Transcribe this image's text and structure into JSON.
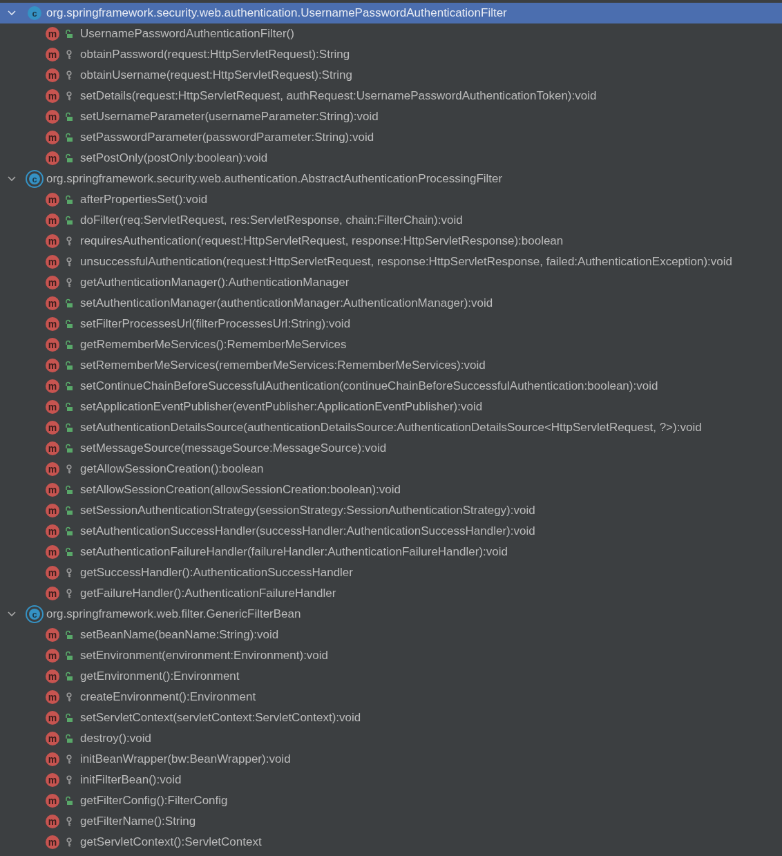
{
  "tree": [
    {
      "badge": "c",
      "name": "org.springframework.security.web.authentication.UsernamePasswordAuthenticationFilter",
      "selected": true,
      "expanded": true,
      "kind": "class",
      "children": [
        {
          "badge": "m",
          "kind": "public",
          "name": "UsernamePasswordAuthenticationFilter()"
        },
        {
          "badge": "m",
          "kind": "protected",
          "name": "obtainPassword(request:HttpServletRequest):String"
        },
        {
          "badge": "m",
          "kind": "protected",
          "name": "obtainUsername(request:HttpServletRequest):String"
        },
        {
          "badge": "m",
          "kind": "protected",
          "name": "setDetails(request:HttpServletRequest, authRequest:UsernamePasswordAuthenticationToken):void"
        },
        {
          "badge": "m",
          "kind": "public",
          "name": "setUsernameParameter(usernameParameter:String):void"
        },
        {
          "badge": "m",
          "kind": "public",
          "name": "setPasswordParameter(passwordParameter:String):void"
        },
        {
          "badge": "m",
          "kind": "public",
          "name": "setPostOnly(postOnly:boolean):void"
        }
      ]
    },
    {
      "badge": "c",
      "name": "org.springframework.security.web.authentication.AbstractAuthenticationProcessingFilter",
      "selected": false,
      "expanded": true,
      "kind": "abstract",
      "children": [
        {
          "badge": "m",
          "kind": "public",
          "name": "afterPropertiesSet():void"
        },
        {
          "badge": "m",
          "kind": "public",
          "name": "doFilter(req:ServletRequest, res:ServletResponse, chain:FilterChain):void"
        },
        {
          "badge": "m",
          "kind": "protected",
          "name": "requiresAuthentication(request:HttpServletRequest, response:HttpServletResponse):boolean"
        },
        {
          "badge": "m",
          "kind": "protected",
          "name": "unsuccessfulAuthentication(request:HttpServletRequest, response:HttpServletResponse, failed:AuthenticationException):void"
        },
        {
          "badge": "m",
          "kind": "protected",
          "name": "getAuthenticationManager():AuthenticationManager"
        },
        {
          "badge": "m",
          "kind": "public",
          "name": "setAuthenticationManager(authenticationManager:AuthenticationManager):void"
        },
        {
          "badge": "m",
          "kind": "public",
          "name": "setFilterProcessesUrl(filterProcessesUrl:String):void"
        },
        {
          "badge": "m",
          "kind": "public",
          "name": "getRememberMeServices():RememberMeServices"
        },
        {
          "badge": "m",
          "kind": "public",
          "name": "setRememberMeServices(rememberMeServices:RememberMeServices):void"
        },
        {
          "badge": "m",
          "kind": "public",
          "name": "setContinueChainBeforeSuccessfulAuthentication(continueChainBeforeSuccessfulAuthentication:boolean):void"
        },
        {
          "badge": "m",
          "kind": "public",
          "name": "setApplicationEventPublisher(eventPublisher:ApplicationEventPublisher):void"
        },
        {
          "badge": "m",
          "kind": "public",
          "name": "setAuthenticationDetailsSource(authenticationDetailsSource:AuthenticationDetailsSource<HttpServletRequest, ?>):void"
        },
        {
          "badge": "m",
          "kind": "public",
          "name": "setMessageSource(messageSource:MessageSource):void"
        },
        {
          "badge": "m",
          "kind": "protected",
          "name": "getAllowSessionCreation():boolean"
        },
        {
          "badge": "m",
          "kind": "public",
          "name": "setAllowSessionCreation(allowSessionCreation:boolean):void"
        },
        {
          "badge": "m",
          "kind": "public",
          "name": "setSessionAuthenticationStrategy(sessionStrategy:SessionAuthenticationStrategy):void"
        },
        {
          "badge": "m",
          "kind": "public",
          "name": "setAuthenticationSuccessHandler(successHandler:AuthenticationSuccessHandler):void"
        },
        {
          "badge": "m",
          "kind": "public",
          "name": "setAuthenticationFailureHandler(failureHandler:AuthenticationFailureHandler):void"
        },
        {
          "badge": "m",
          "kind": "protected",
          "name": "getSuccessHandler():AuthenticationSuccessHandler"
        },
        {
          "badge": "m",
          "kind": "protected",
          "name": "getFailureHandler():AuthenticationFailureHandler"
        }
      ]
    },
    {
      "badge": "c",
      "name": "org.springframework.web.filter.GenericFilterBean",
      "selected": false,
      "expanded": true,
      "kind": "abstract",
      "children": [
        {
          "badge": "m",
          "kind": "public",
          "name": "setBeanName(beanName:String):void"
        },
        {
          "badge": "m",
          "kind": "public",
          "name": "setEnvironment(environment:Environment):void"
        },
        {
          "badge": "m",
          "kind": "public",
          "name": "getEnvironment():Environment"
        },
        {
          "badge": "m",
          "kind": "protected",
          "name": "createEnvironment():Environment"
        },
        {
          "badge": "m",
          "kind": "public",
          "name": "setServletContext(servletContext:ServletContext):void"
        },
        {
          "badge": "m",
          "kind": "public",
          "name": "destroy():void"
        },
        {
          "badge": "m",
          "kind": "protected",
          "name": "initBeanWrapper(bw:BeanWrapper):void"
        },
        {
          "badge": "m",
          "kind": "protected",
          "name": "initFilterBean():void"
        },
        {
          "badge": "m",
          "kind": "public",
          "name": "getFilterConfig():FilterConfig"
        },
        {
          "badge": "m",
          "kind": "protected",
          "name": "getFilterName():String"
        },
        {
          "badge": "m",
          "kind": "protected",
          "name": "getServletContext():ServletContext"
        }
      ]
    }
  ]
}
